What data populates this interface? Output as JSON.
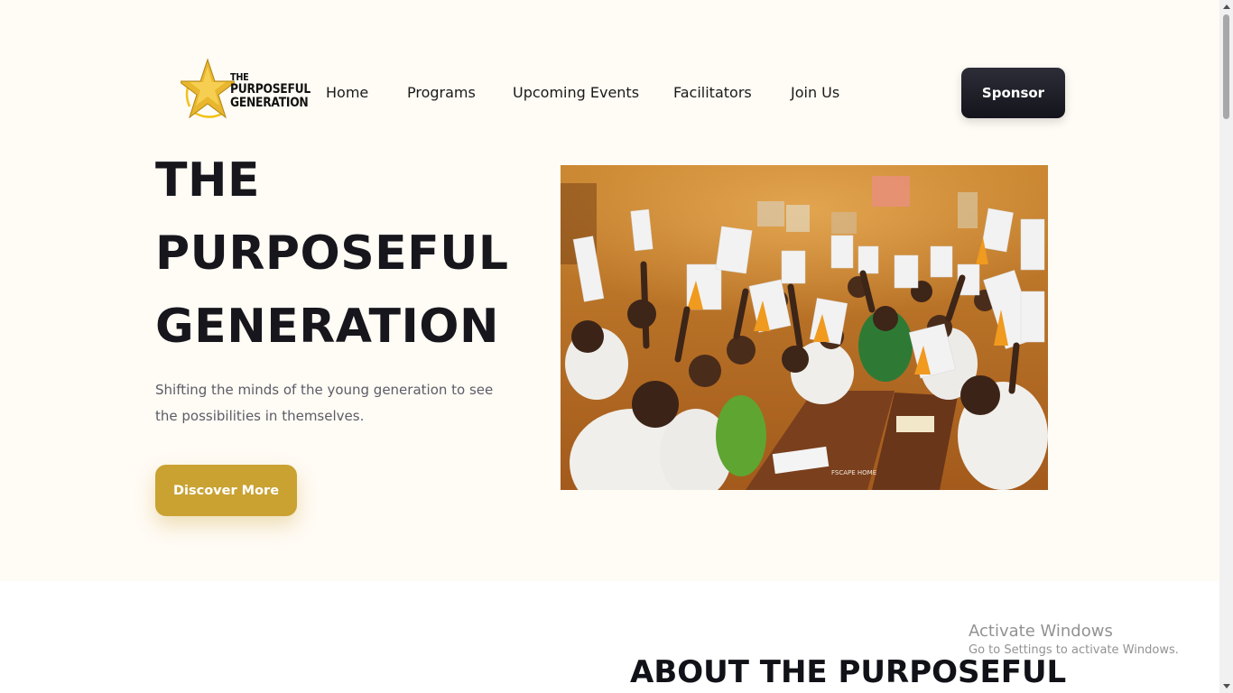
{
  "brand": {
    "logo_lines": [
      "THE",
      "PURPOSEFUL",
      "GENERATION"
    ]
  },
  "nav": {
    "items": [
      {
        "label": "Home"
      },
      {
        "label": "Programs"
      },
      {
        "label": "Upcoming Events"
      },
      {
        "label": "Facilitators"
      },
      {
        "label": "Join Us"
      }
    ],
    "sponsor_label": "Sponsor"
  },
  "hero": {
    "title_lines": [
      "THE",
      "PURPOSEFUL",
      "GENERATION"
    ],
    "subtitle": "Shifting the minds of the young generation to see the possibilities in themselves.",
    "cta_label": "Discover More",
    "photo_watermark": "FSCAPE HOME"
  },
  "about": {
    "title": "ABOUT THE PURPOSEFUL"
  },
  "windows_notice": {
    "line1": "Activate Windows",
    "line2": "Go to Settings to activate Windows."
  },
  "colors": {
    "hero_bg": "#fffbf5",
    "accent_gold": "#c9a232",
    "sponsor_dark": "#1c1c24",
    "title_text": "#16161c"
  },
  "icons": {
    "logo": "gold-star-icon"
  }
}
